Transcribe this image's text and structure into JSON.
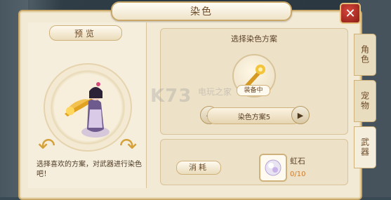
{
  "window": {
    "title": "染色"
  },
  "title_deco": {
    "left_text": "",
    "right_text": ""
  },
  "preview": {
    "label": "预览",
    "tip": "选择喜欢的方案，对武器进行染色吧！"
  },
  "scheme": {
    "title": "选择染色方案",
    "equipped_label": "装备中",
    "current_scheme": "染色方案5",
    "prev_icon": "◀",
    "next_icon": "▶"
  },
  "cost": {
    "label": "消耗",
    "item_name": "虹石",
    "item_count": "0/10"
  },
  "tabs": [
    {
      "label": "角色"
    },
    {
      "label": "宠物"
    },
    {
      "label": "武器"
    }
  ],
  "watermark": {
    "text": "K73",
    "sub": "电玩之家"
  },
  "icons": {
    "close": "close-icon",
    "weapon": "weapon-icon",
    "gem": "gem-icon",
    "rotate_left": "rotate-left-icon",
    "rotate_right": "rotate-right-icon"
  },
  "colors": {
    "accent_gold": "#d5a13a",
    "close_red": "#b12a22",
    "count_orange": "#d07b2c"
  }
}
